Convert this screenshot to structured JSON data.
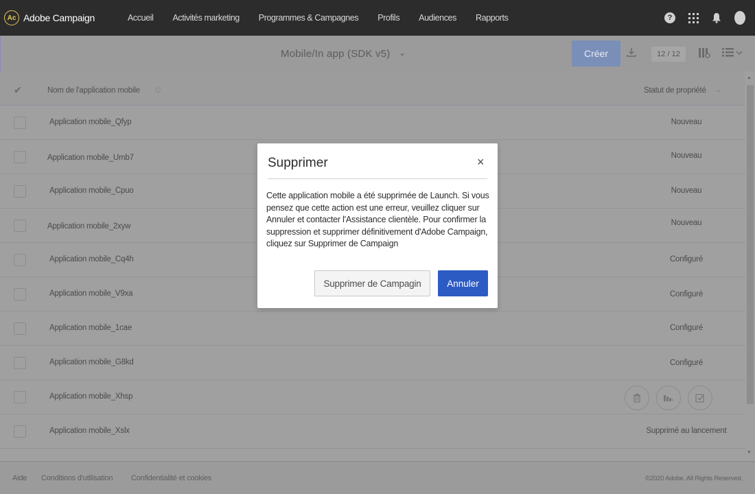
{
  "brand": {
    "logo_text": "Ac",
    "name": "Adobe Campaign"
  },
  "nav": {
    "items": [
      {
        "label": "Accueil"
      },
      {
        "label": "Activités marketing"
      },
      {
        "label": "Programmes & Campagnes"
      },
      {
        "label": "Profils"
      },
      {
        "label": "Audiences"
      },
      {
        "label": "Rapports"
      }
    ],
    "help_glyph": "?"
  },
  "toolbar": {
    "view_title": "Mobile/In app (SDK v5)",
    "create_label": "Créer",
    "counter": "12 / 12"
  },
  "table": {
    "col_name": "Nom de l'application mobile",
    "col_status": "Statut de propriété",
    "rows": [
      {
        "name": "Application mobile_Qfyp",
        "status": "Nouveau"
      },
      {
        "name": "Application mobile_Umb7",
        "status": "Nouveau"
      },
      {
        "name": "Application mobile_Cpuo",
        "status": "Nouveau"
      },
      {
        "name": "Application mobile_2xyw",
        "status": "Nouveau"
      },
      {
        "name": "Application mobile_Cq4h",
        "status": "Configuré"
      },
      {
        "name": "Application mobile_V9xa",
        "status": "Configuré"
      },
      {
        "name": "Application mobile_1cae",
        "status": "Configuré"
      },
      {
        "name": "Application mobile_G8kd",
        "status": "Configuré"
      },
      {
        "name": "Application mobile_Xhsp",
        "status": ""
      },
      {
        "name": "Application mobile_Xslx",
        "status": "Supprimé au lancement"
      }
    ]
  },
  "footer": {
    "help": "Aide",
    "terms": "Conditions d'utilisation",
    "privacy": "Confidentialité et cookies",
    "copyright": "©2020 Adobe. All Rights Reserved."
  },
  "modal": {
    "title": "Supprimer",
    "close_glyph": "×",
    "body": "Cette application mobile a été supprimée de Launch. Si vous pensez que cette action est une erreur, veuillez cliquer sur Annuler et contacter l'Assistance clientèle. Pour confirmer la suppression et supprimer définitivement d'Adobe Campaign, cliquez sur Supprimer de Campaign",
    "secondary_label": "Supprimer de Campagin",
    "primary_label": "Annuler"
  },
  "colors": {
    "nav_bg": "#2c2c2c",
    "primary": "#2d5bc4",
    "create_dimmed": "#7a8fb8",
    "overlay_bg": "#9b9b9b"
  }
}
